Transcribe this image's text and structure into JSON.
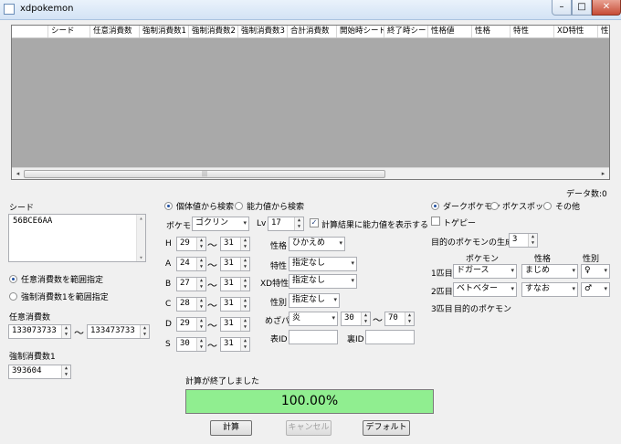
{
  "window": {
    "title": "xdpokemon",
    "min_glyph": "–",
    "max_glyph": "□",
    "close_glyph": "✕"
  },
  "grid": {
    "columns": [
      "シード",
      "任意消費数",
      "強制消費数1",
      "強制消費数2",
      "強制消費数3",
      "合計消費数",
      "開始時シード",
      "終了時シード",
      "性格値",
      "性格",
      "特性",
      "XD特性",
      "性"
    ],
    "scroll_left": "◂",
    "scroll_right": "▸",
    "scroll_thumb": "|||"
  },
  "data_count": "データ数:0",
  "seed": {
    "label": "シード",
    "value": "56BCE6AA"
  },
  "consume_mode": {
    "option1": "任意消費数を範囲指定",
    "option2": "強制消費数1を範囲指定",
    "selected": 1
  },
  "optional_consume": {
    "label": "任意消費数",
    "from": "133073733",
    "to": "133473733",
    "tilde": "～"
  },
  "forced_consume1": {
    "label": "強制消費数1",
    "value": "393604"
  },
  "search_mode": {
    "iv_search": "個体値から検索",
    "stat_search": "能力値から検索",
    "selected": 1
  },
  "pokemon": {
    "label": "ポケモン",
    "value": "ゴクリン"
  },
  "level": {
    "label": "Lv",
    "value": "17"
  },
  "show_stats": {
    "label": "計算結果に能力値を表示する",
    "checked": true,
    "check_glyph": "✓"
  },
  "ivs": {
    "tilde": "～",
    "rows": [
      {
        "stat": "H",
        "min": "29",
        "max": "31"
      },
      {
        "stat": "A",
        "min": "24",
        "max": "31"
      },
      {
        "stat": "B",
        "min": "27",
        "max": "31"
      },
      {
        "stat": "C",
        "min": "28",
        "max": "31"
      },
      {
        "stat": "D",
        "min": "29",
        "max": "31"
      },
      {
        "stat": "S",
        "min": "30",
        "max": "31"
      }
    ]
  },
  "nature": {
    "label": "性格",
    "value": "ひかえめ"
  },
  "ability": {
    "label": "特性",
    "value": "指定なし"
  },
  "xd_ability": {
    "label": "XD特性",
    "value": "指定なし"
  },
  "gender": {
    "label": "性別",
    "value": "指定なし"
  },
  "hidden_power": {
    "label": "めざパ",
    "type": "炎",
    "min": "30",
    "max": "70",
    "tilde": "～"
  },
  "tid": {
    "label": "表ID",
    "value": ""
  },
  "sid": {
    "label": "裏ID",
    "value": ""
  },
  "target_kind": {
    "dark": "ダークポケモン",
    "pokespot": "ポケスポット",
    "other": "その他",
    "selected": 1
  },
  "togepi": {
    "label": "トゲピー",
    "checked": false
  },
  "gen_order": {
    "label": "目的のポケモンの生成順",
    "value": "3"
  },
  "party": {
    "header_pokemon": "ポケモン",
    "header_nature": "性格",
    "header_gender": "性別",
    "rows": [
      {
        "label": "1匹目",
        "pokemon": "ドガース",
        "nature": "まじめ",
        "gender": "♀"
      },
      {
        "label": "2匹目",
        "pokemon": "ベトベター",
        "nature": "すなお",
        "gender": "♂"
      }
    ],
    "third_label": "3匹目",
    "third_value": "目的のポケモン"
  },
  "status_text": "計算が終了しました",
  "progress": {
    "value": 1.0,
    "label": "100.00%",
    "color": "#90ee90"
  },
  "buttons": {
    "calc": "計算",
    "cancel": "キャンセル",
    "default": "デフォルト"
  },
  "icons": {
    "dropdown": "▾",
    "spin_up": "▲",
    "spin_down": "▼",
    "scroll_up": "▴",
    "scroll_down": "▾"
  }
}
